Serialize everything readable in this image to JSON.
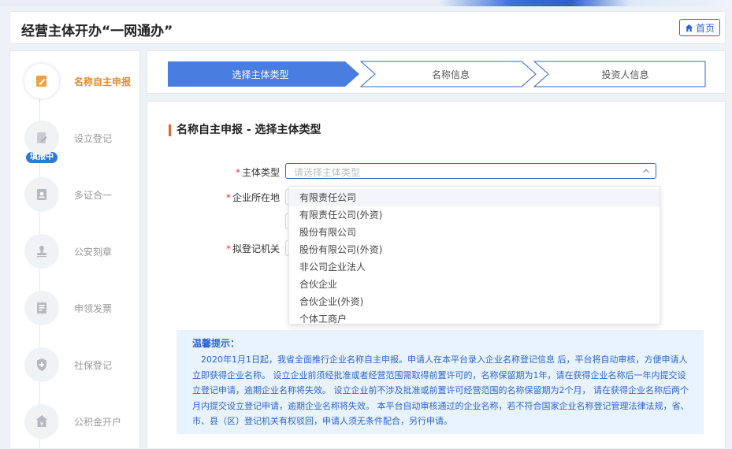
{
  "header": {
    "title": "经营主体开办“一网通办”",
    "home_label": "首页"
  },
  "sidebar": {
    "badge": "填报中",
    "steps": [
      {
        "label": "名称自主申报",
        "icon": "edit-icon",
        "active": true
      },
      {
        "label": "设立登记",
        "icon": "document-edit-icon",
        "active": false
      },
      {
        "label": "多证合一",
        "icon": "id-card-icon",
        "active": false
      },
      {
        "label": "公安刻章",
        "icon": "stamp-icon",
        "active": false
      },
      {
        "label": "申领发票",
        "icon": "invoice-icon",
        "active": false
      },
      {
        "label": "社保登记",
        "icon": "social-security-icon",
        "active": false
      },
      {
        "label": "公积金开户",
        "icon": "housing-fund-icon",
        "active": false
      }
    ]
  },
  "progress": {
    "steps": [
      "选择主体类型",
      "名称信息",
      "投资人信息"
    ],
    "active_index": 0
  },
  "form": {
    "section_title": "名称自主申报 - 选择主体类型",
    "entity_type_label": "主体类型",
    "entity_type_placeholder": "请选择主体类型",
    "location_label": "企业所在地",
    "registry_label": "拟登记机关"
  },
  "dropdown": {
    "options": [
      "有限责任公司",
      "有限责任公司(外资)",
      "股份有限公司",
      "股份有限公司(外资)",
      "非公司企业法人",
      "合伙企业",
      "合伙企业(外资)",
      "个体工商户"
    ],
    "hover_index": 0
  },
  "tips": {
    "title": "温馨提示：",
    "text": "2020年1月1日起，我省全面推行企业名称自主申报。申请人在本平台录入企业名称登记信息 后，平台将自动审核，方便申请人立即获得企业名称。 设立企业前须经批准或者经营范围需取得前置许可的，名称保留期为1年，请在获得企业名称后一年内提交设立登记申请，逾期企业名称将失效。 设立企业前不涉及批准或前置许可经营范围的名称保留期为2个月， 请在获得企业名称后两个月内提交设立登记申请，逾期企业名称将失效。 本平台自动审核通过的企业名称，若不符合国家企业名称登记管理法律法规，省、市、县（区）登记机关有权驳回，申请人须无条件配合，另行申请。"
  },
  "colors": {
    "primary": "#2e64d6",
    "active_step": "#e58a2e",
    "required": "#e23a3a",
    "tips_bg": "#e8f3fd"
  }
}
